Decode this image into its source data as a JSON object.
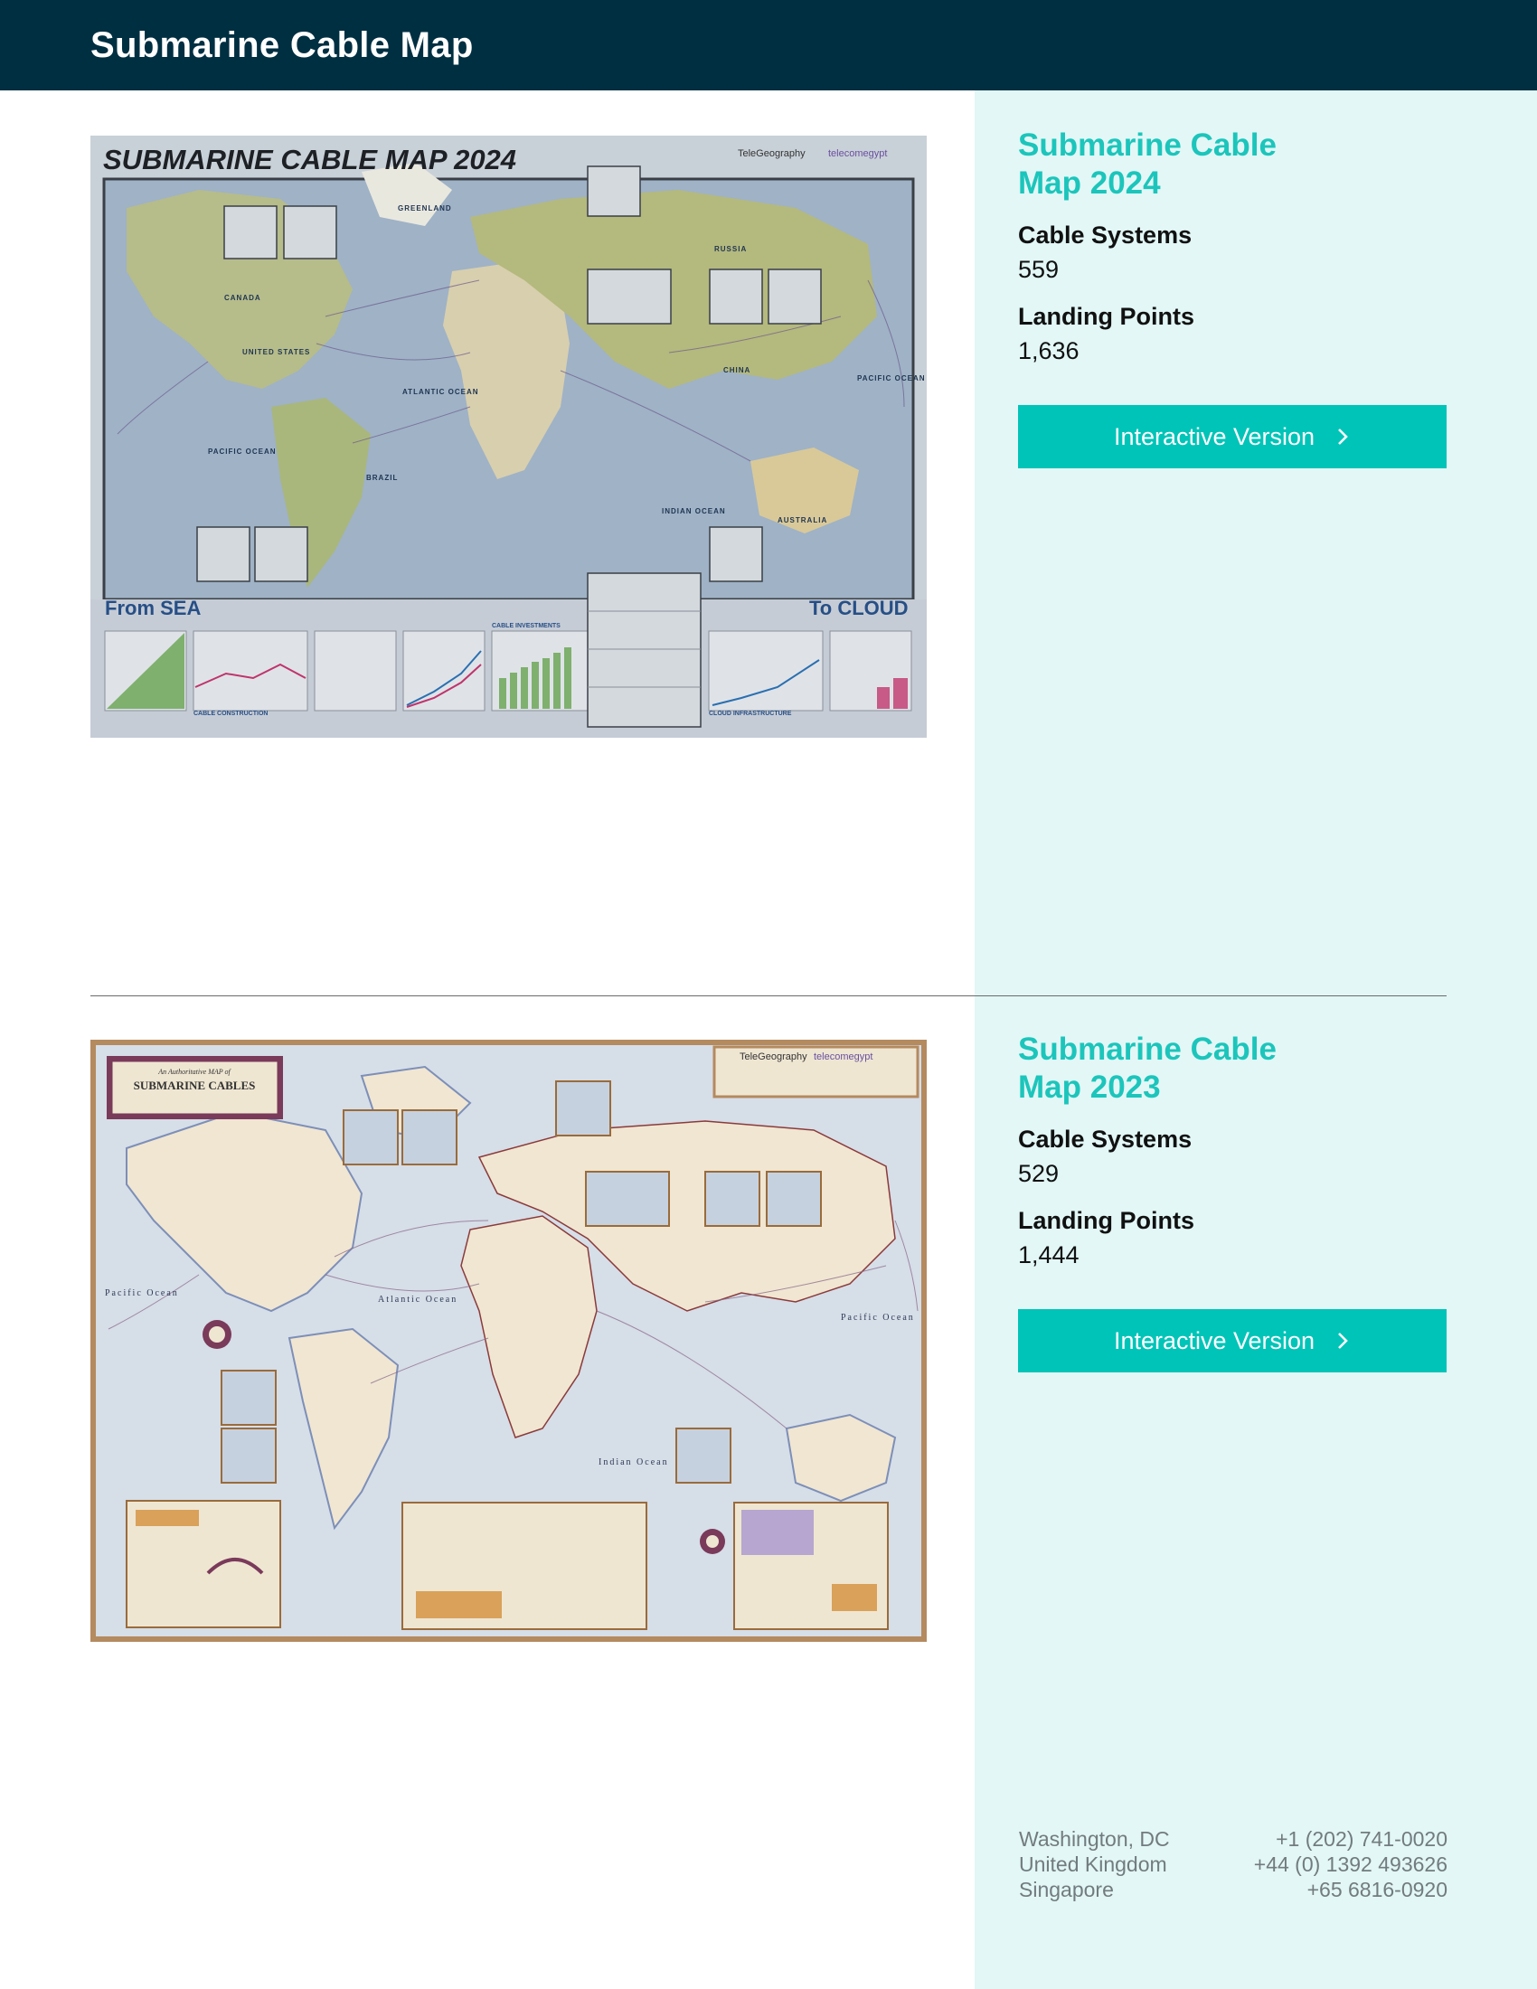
{
  "header": {
    "title": "Submarine Cable Map"
  },
  "maps": [
    {
      "title": "Submarine Cable Map 2024",
      "cable_systems_label": "Cable Systems",
      "cable_systems_value": "559",
      "landing_points_label": "Landing Points",
      "landing_points_value": "1,636",
      "button_label": "Interactive Version",
      "poster": {
        "heading": "SUBMARINE CABLE MAP 2024",
        "brand_left": "TeleGeography",
        "brand_right": "telecomegypt",
        "footer_left": "From SEA",
        "footer_right": "To CLOUD",
        "labels": [
          "CANADA",
          "UNITED STATES",
          "ATLANTIC OCEAN",
          "PACIFIC OCEAN",
          "BRAZIL",
          "RUSSIA",
          "CHINA",
          "INDIAN OCEAN",
          "AUSTRALIA",
          "PACIFIC OCEAN",
          "GREENLAND",
          "CABLE CONSTRUCTION",
          "CABLE INVESTMENTS",
          "CLOUD INFRASTRUCTURE"
        ]
      }
    },
    {
      "title": "Submarine Cable Map 2023",
      "cable_systems_label": "Cable Systems",
      "cable_systems_value": "529",
      "landing_points_label": "Landing Points",
      "landing_points_value": "1,444",
      "button_label": "Interactive Version",
      "poster": {
        "heading_small": "An Authoritative MAP of",
        "heading": "SUBMARINE CABLES",
        "brand_left": "TeleGeography",
        "brand_right": "telecomegypt",
        "labels": [
          "Pacific Ocean",
          "Atlantic Ocean",
          "Indian Ocean",
          "Pacific Ocean"
        ]
      }
    }
  ],
  "footer": {
    "offices": [
      {
        "city": "Washington, DC",
        "phone": "+1 (202) 741-0020"
      },
      {
        "city": "United Kingdom",
        "phone": "+44 (0) 1392 493626"
      },
      {
        "city": "Singapore",
        "phone": "+65 6816-0920"
      }
    ]
  },
  "colors": {
    "header_bg": "#002f42",
    "panel_bg": "#e2f7f6",
    "accent": "#1cc5bb",
    "button_bg": "#00c4b8"
  },
  "icons": {
    "button_icon": "chevron-right-icon"
  }
}
